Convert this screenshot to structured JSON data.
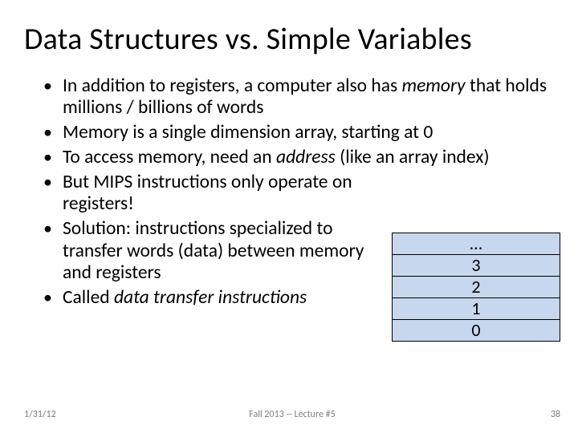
{
  "title": "Data Structures vs. Simple Variables",
  "bullets": [
    {
      "pre": "In addition to registers, a computer also has ",
      "em": "memory",
      "post": " that holds millions / billions of words",
      "narrow": false
    },
    {
      "pre": "Memory is a single dimension array, starting at 0",
      "em": "",
      "post": "",
      "narrow": false
    },
    {
      "pre": "To access memory, need an ",
      "em": "address",
      "post": " (like an array index)",
      "narrow": false
    },
    {
      "pre": "But MIPS instructions only operate on registers!",
      "em": "",
      "post": "",
      "narrow": true
    },
    {
      "pre": "Solution: instructions specialized to transfer words (data) between memory and registers",
      "em": "",
      "post": "",
      "narrow": true
    },
    {
      "pre": "Called ",
      "em": "data transfer instructions",
      "post": "",
      "narrow": true
    }
  ],
  "memstack": [
    "…",
    "3",
    "2",
    "1",
    "0"
  ],
  "footer": {
    "left": "1/31/12",
    "center": "Fall 2013 -- Lecture #5",
    "right": "38"
  }
}
